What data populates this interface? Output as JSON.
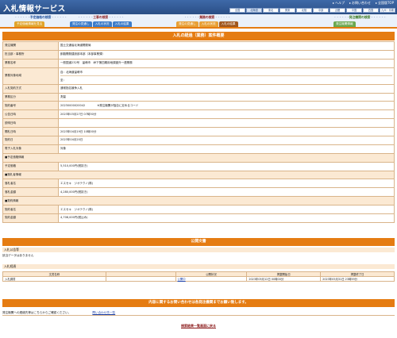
{
  "app_title": "入札情報サービス",
  "top_links": [
    "ヘルプ",
    "お問い合わせ",
    "全国版TOP"
  ],
  "regions": [
    "全国",
    "北海道",
    "東北",
    "関東",
    "北陸",
    "中部",
    "近畿",
    "中国",
    "四国",
    "九州・沖縄"
  ],
  "active_region_index": 1,
  "nav": {
    "group1": {
      "title": "予定価格の検索",
      "tabs": [
        "予定価格情報を見る"
      ]
    },
    "group2": {
      "title": "工事の検索",
      "tabs": [
        "発注の見通し",
        "入札の状況",
        "入札の結果"
      ]
    },
    "group3": {
      "title": "業務の検索",
      "tabs": [
        "発注の見通し",
        "入札の状況",
        "入札の結果"
      ]
    },
    "group4": {
      "title": "発注機関の検索",
      "tabs": [
        "発注機関情報"
      ]
    }
  },
  "page_title": "入札の経過（業務）案件概要",
  "detail": {
    "orderer_label": "発注機関",
    "orderer": "国土交通省北海道開発局",
    "office_label": "担当部・事務所",
    "office": "釧路開発建設部本部（本部事業課）",
    "name_label": "業務名称",
    "name": "一般国道232号　留萌市　峠下第四期用地調査外一連業務",
    "location_label": "業務対象地域",
    "location_lines": [
      "自：北海道留萌市",
      "至："
    ],
    "method_label": "入札契約方式",
    "method": "通常指名競争入札",
    "category_label": "業務区分",
    "category": "測量",
    "number_label": "契約番号",
    "number": "20230000020042",
    "number_note": "※発注機関が独自に定めるコード",
    "announce_label": "公告日時",
    "announce": "2023年03月27日 07時30分",
    "briefing_label": "説明日時",
    "briefing": "",
    "opening_label": "開札日時",
    "opening": "2023年04月19日 10時00分",
    "contract_date_label": "契約日",
    "contract_date": "2023年04月20日",
    "electronic_label": "電子入札対象",
    "electronic": "対象",
    "price_section": "■予定価格情報",
    "price_label": "予定価格",
    "price": "5,510,000円(税抜き)",
    "winner_section": "■落札者情報",
    "winner_label": "落札者名",
    "winner": "エスセキ　ジオテクノ(株)",
    "winner_amount_label": "落札金額",
    "winner_amount": "4,280,000円(税抜き)",
    "contract_section": "■契約情報",
    "contractor_label": "契約者名",
    "contractor": "エスセキ　ジオテクノ(株)",
    "contract_amount_label": "契約金額",
    "contract_amount": "4,708,000円(税込み)"
  },
  "public_docs": {
    "title": "公開文書",
    "notice_head": "入札公告等",
    "notice_empty": "該当データはありません",
    "process_head": "入札経過",
    "columns": [
      "文書名称",
      "",
      "公開状況",
      "掲載開始日",
      "掲載終了日"
    ],
    "rows": [
      [
        "入札調書",
        "",
        "公開中",
        "2023年05月12日 00時00分",
        "2023年05月31日 23時59分"
      ]
    ]
  },
  "inquiry": {
    "bar": "内容に関するお問い合わせは各発注機関までお願い致します。",
    "text": "発注機関への連絡先等はこちらからご確認ください。",
    "link": "問い合わせ先一覧"
  },
  "back_link": "検索結果一覧画面に戻る",
  "colors": {
    "header": "#2a4e85",
    "accent": "#e57c12",
    "label_bg": "#fbe9d3"
  }
}
